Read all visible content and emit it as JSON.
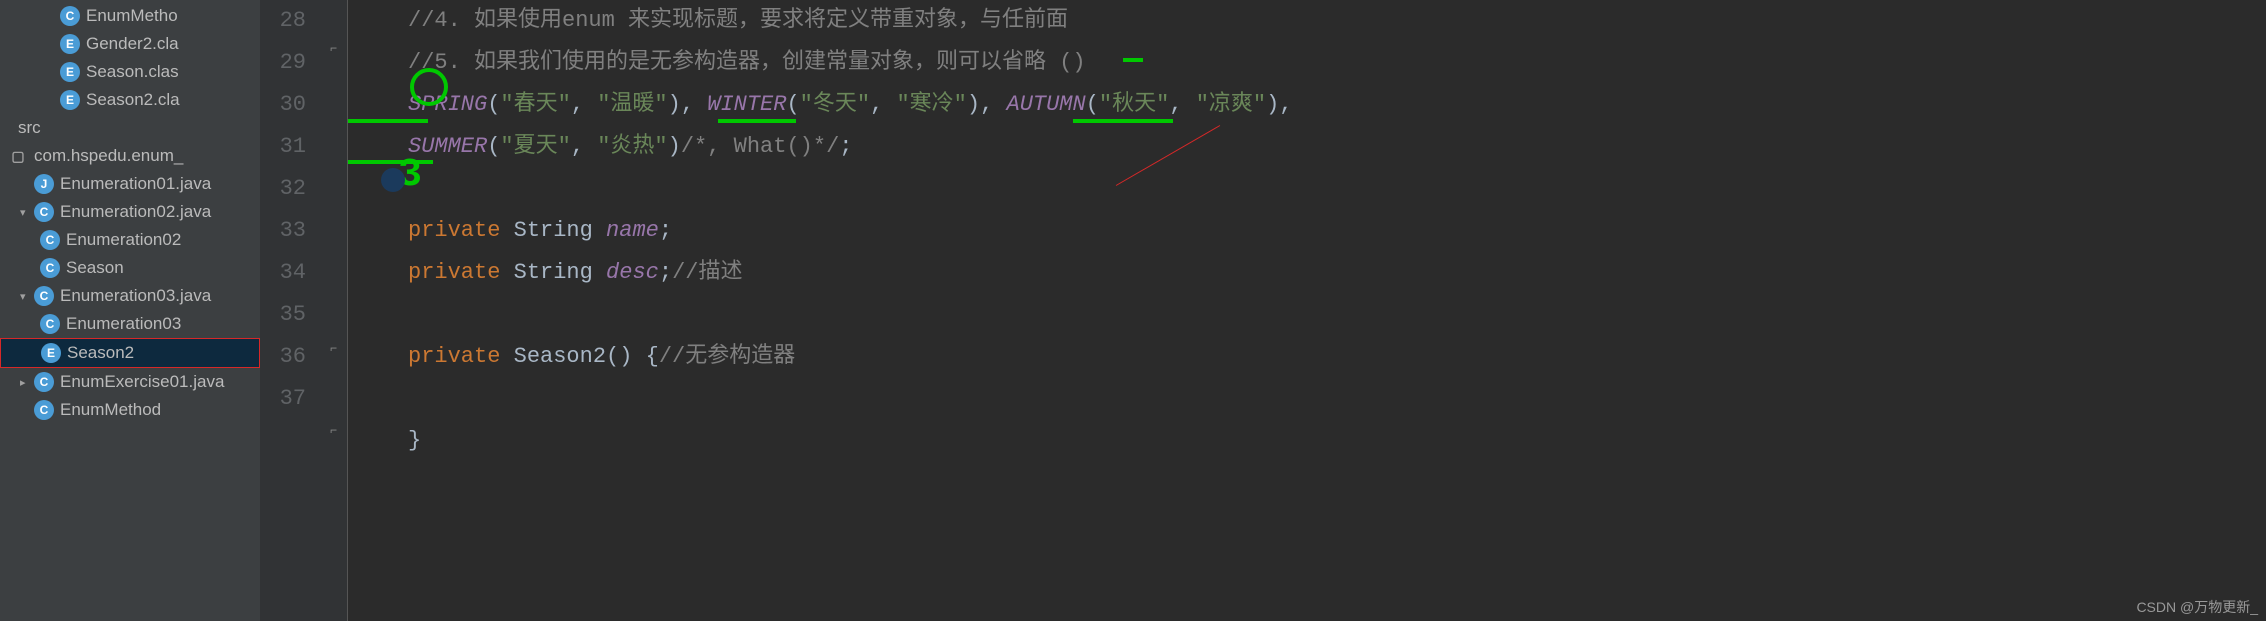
{
  "sidebar": {
    "items": [
      {
        "label": "EnumMetho",
        "icon": "C",
        "indent": 3
      },
      {
        "label": "Gender2.cla",
        "icon": "E",
        "indent": 3
      },
      {
        "label": "Season.clas",
        "icon": "E",
        "indent": 3
      },
      {
        "label": "Season2.cla",
        "icon": "E",
        "indent": 3
      }
    ],
    "src_label": "src",
    "package": "com.hspedu.enum_",
    "files": [
      {
        "label": "Enumeration01.java",
        "icon": "J",
        "indent": 1,
        "chevron": ""
      },
      {
        "label": "Enumeration02.java",
        "icon": "C",
        "indent": 1,
        "chevron": "v"
      },
      {
        "label": "Enumeration02",
        "icon": "C",
        "indent": 2,
        "chevron": ""
      },
      {
        "label": "Season",
        "icon": "C",
        "indent": 2,
        "chevron": ""
      },
      {
        "label": "Enumeration03.java",
        "icon": "C",
        "indent": 1,
        "chevron": "v"
      },
      {
        "label": "Enumeration03",
        "icon": "C",
        "indent": 2,
        "chevron": ""
      },
      {
        "label": "Season2",
        "icon": "E",
        "indent": 2,
        "chevron": "",
        "selected": true
      },
      {
        "label": "EnumExercise01.java",
        "icon": "C",
        "indent": 1,
        "chevron": ">"
      },
      {
        "label": "EnumMethod",
        "icon": "C",
        "indent": 1,
        "chevron": ""
      }
    ]
  },
  "gutter": {
    "lines": [
      "",
      "28",
      "29",
      "30",
      "31",
      "32",
      "33",
      "34",
      "35",
      "36",
      "37"
    ]
  },
  "code": {
    "line27": "//4. 如果使用enum 来实现标题，要求将定义带重对象，与任前面",
    "line28": "//5. 如果我们使用的是无参构造器，创建常量对象，则可以省略 ()",
    "line29": {
      "s1": "SPRING",
      "s1a": "(",
      "s1b": "\"春天\"",
      "s1c": ", ",
      "s1d": "\"温暖\"",
      "s1e": "), ",
      "s2": "WINTER",
      "s2a": "(",
      "s2b": "\"冬天\"",
      "s2c": ", ",
      "s2d": "\"寒冷\"",
      "s2e": "), ",
      "s3": "AUTUMN",
      "s3a": "(",
      "s3b": "\"秋天\"",
      "s3c": ", ",
      "s3d": "\"凉爽\"",
      "s3e": "),"
    },
    "line30": {
      "s1": "SUMMER",
      "s1a": "(",
      "s1b": "\"夏天\"",
      "s1c": ", ",
      "s1d": "\"炎热\"",
      "s1e": ")",
      "cmt": "/*, What()*/",
      "end": ";"
    },
    "line32": {
      "kw": "private ",
      "type": "String ",
      "name": "name",
      "end": ";"
    },
    "line33": {
      "kw": "private ",
      "type": "String ",
      "name": "desc",
      "end": ";",
      "cmt": "//描述"
    },
    "line35": {
      "kw": "private ",
      "method": "Season2",
      "params": "() {",
      "cmt": "//无参构造器"
    },
    "line37": "}"
  },
  "watermark": "CSDN @万物更新_"
}
